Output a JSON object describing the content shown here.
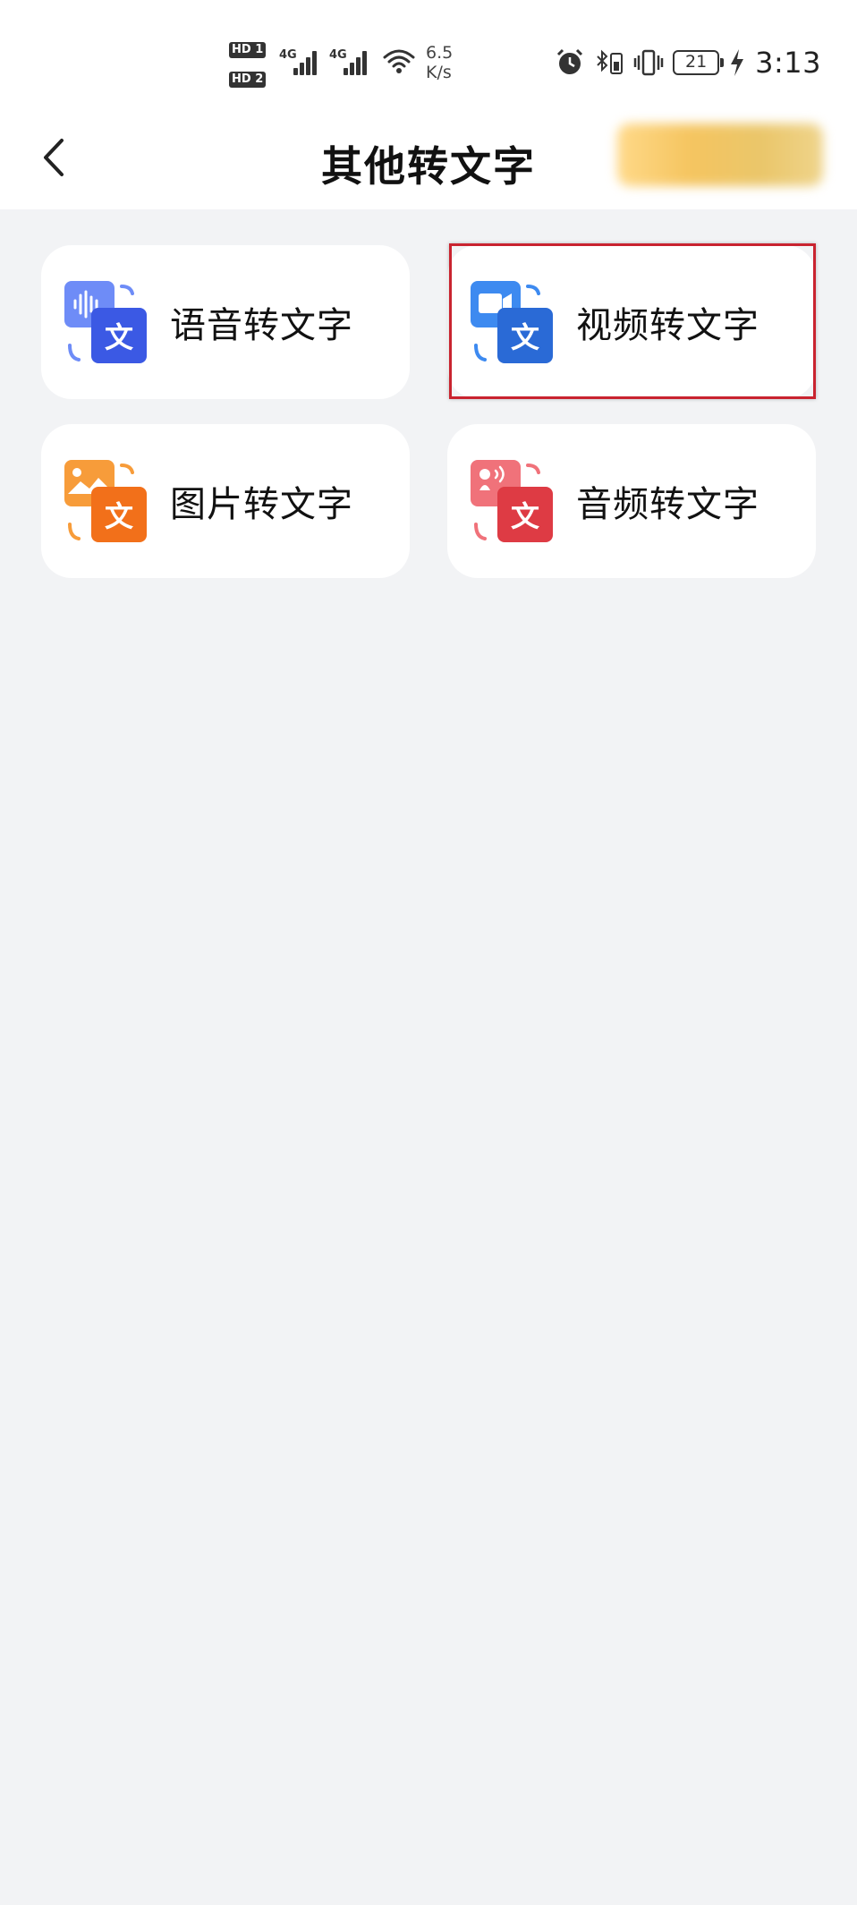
{
  "status_bar": {
    "hd1": "HD",
    "hd1_num": "1",
    "hd2": "HD",
    "hd2_num": "2",
    "net1": "4G",
    "net2": "4G",
    "speed_value": "6.5",
    "speed_unit": "K/s",
    "battery": "21",
    "time": "3:13"
  },
  "header": {
    "title": "其他转文字",
    "back_icon": "chevron-left-icon"
  },
  "cards": [
    {
      "label": "语音转文字",
      "icon": "voice-to-text-icon",
      "color": "#4a6cf0"
    },
    {
      "label": "视频转文字",
      "icon": "video-to-text-icon",
      "color": "#2f74e0"
    },
    {
      "label": "图片转文字",
      "icon": "image-to-text-icon",
      "color": "#f27c1e"
    },
    {
      "label": "音频转文字",
      "icon": "audio-to-text-icon",
      "color": "#e0414a"
    }
  ],
  "colors": {
    "background": "#f2f3f5",
    "highlight": "#c9232f"
  }
}
